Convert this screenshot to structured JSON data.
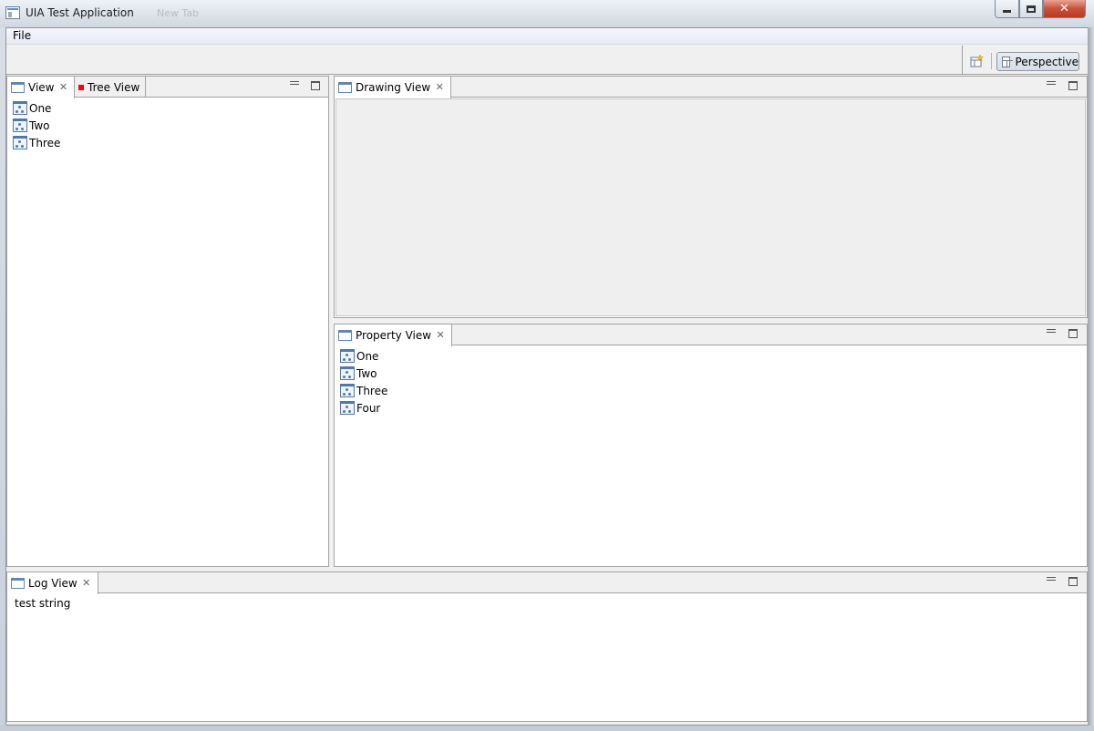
{
  "window": {
    "title": "UIA Test Application",
    "ghost_tab_label": "New Tab"
  },
  "menubar": {
    "file_label": "File"
  },
  "toolbar": {
    "perspective_label": "Perspective",
    "open_perspective_icon": "open-perspective-icon"
  },
  "left_panel": {
    "tabs": [
      {
        "label": "View",
        "icon": "view-icon",
        "active": true,
        "closable": true
      },
      {
        "label": "Tree View",
        "icon": "red-square-icon",
        "active": false,
        "closable": false
      }
    ],
    "items": [
      "One",
      "Two",
      "Three"
    ]
  },
  "drawing_panel": {
    "tab_label": "Drawing View"
  },
  "property_panel": {
    "tab_label": "Property View",
    "items": [
      "One",
      "Two",
      "Three",
      "Four"
    ]
  },
  "log_panel": {
    "tab_label": "Log View",
    "text": "test string"
  },
  "colors": {
    "close_button": "#c9503a",
    "tree_view_marker": "#e01010",
    "icon_blue": "#4f79a8"
  }
}
